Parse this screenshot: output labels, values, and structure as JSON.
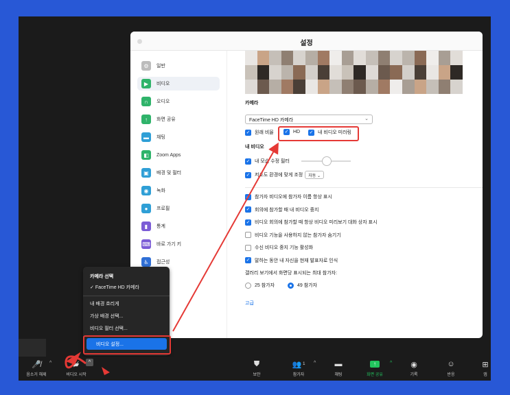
{
  "settings": {
    "window_title": "설정",
    "sidebar": [
      {
        "label": "일반",
        "icon": "gear-icon",
        "color": "#bcbcbc"
      },
      {
        "label": "비디오",
        "icon": "video-camera-icon",
        "color": "#2fb36a",
        "active": true
      },
      {
        "label": "오디오",
        "icon": "headphones-icon",
        "color": "#2fb36a"
      },
      {
        "label": "화면 공유",
        "icon": "share-screen-icon",
        "color": "#2fb36a"
      },
      {
        "label": "채팅",
        "icon": "chat-icon",
        "color": "#2f9fd6"
      },
      {
        "label": "Zoom Apps",
        "icon": "apps-icon",
        "color": "#2fb36a"
      },
      {
        "label": "배경 및 필터",
        "icon": "background-icon",
        "color": "#2f9fd6"
      },
      {
        "label": "녹화",
        "icon": "record-icon",
        "color": "#2f9fd6"
      },
      {
        "label": "프로필",
        "icon": "profile-icon",
        "color": "#2f9fd6"
      },
      {
        "label": "통계",
        "icon": "stats-icon",
        "color": "#7b5cd6"
      },
      {
        "label": "바로 가기 키",
        "icon": "keyboard-icon",
        "color": "#7b5cd6"
      },
      {
        "label": "접근성",
        "icon": "accessibility-icon",
        "color": "#2f6fd6"
      }
    ],
    "camera_section": "카메라",
    "camera_select": "FaceTime HD 카메라",
    "original_ratio": "원래 비율",
    "hd": "HD",
    "mirror": "내 비디오 미러링",
    "my_video_section": "내 비디오",
    "touch_up": "내 모습 수정 필터",
    "low_light": "저조도 환경에 맞게 조정",
    "low_light_mode": "자동",
    "options": [
      {
        "label": "참가자 비디오에 참가자 이름 항상 표시",
        "checked": true
      },
      {
        "label": "회의에 참가할 때 내 비디오 중지",
        "checked": true
      },
      {
        "label": "비디오 회의에 참가할 때 항상 비디오 미리보기 대화 상자 표시",
        "checked": true
      },
      {
        "label": "비디오 기능을 사용하지 않는 참가자 숨기기",
        "checked": false
      },
      {
        "label": "수신 비디오 중지 기능 활성화",
        "checked": false
      },
      {
        "label": "말하는 동안 내 자신을 현재 발표자로 인식",
        "checked": true
      }
    ],
    "gallery_max": "갤러리 보기에서 화면당 표시되는 최대 참가자:",
    "radio_25": "25 참가자",
    "radio_49": "49 참가자",
    "advanced": "고급"
  },
  "camera_menu": {
    "header": "카메라 선택",
    "camera": "FaceTime HD 카메라",
    "blur": "내 배경 흐리게",
    "virtual_bg": "가상 배경 선택...",
    "video_filter": "비디오 필터 선택...",
    "video_settings": "비디오 설정..."
  },
  "toolbar": {
    "unmute": "음소거 해제",
    "start_video": "비디오 시작",
    "security": "보안",
    "participants": "참가자",
    "participants_count": "1",
    "chat": "채팅",
    "share_screen": "화면 공유",
    "record": "기록",
    "reactions": "반응",
    "apps": "앱"
  },
  "colors": {
    "accent": "#1a73e8",
    "highlight": "#e53935",
    "background": "#2858d6",
    "share_green": "#22c55e"
  }
}
